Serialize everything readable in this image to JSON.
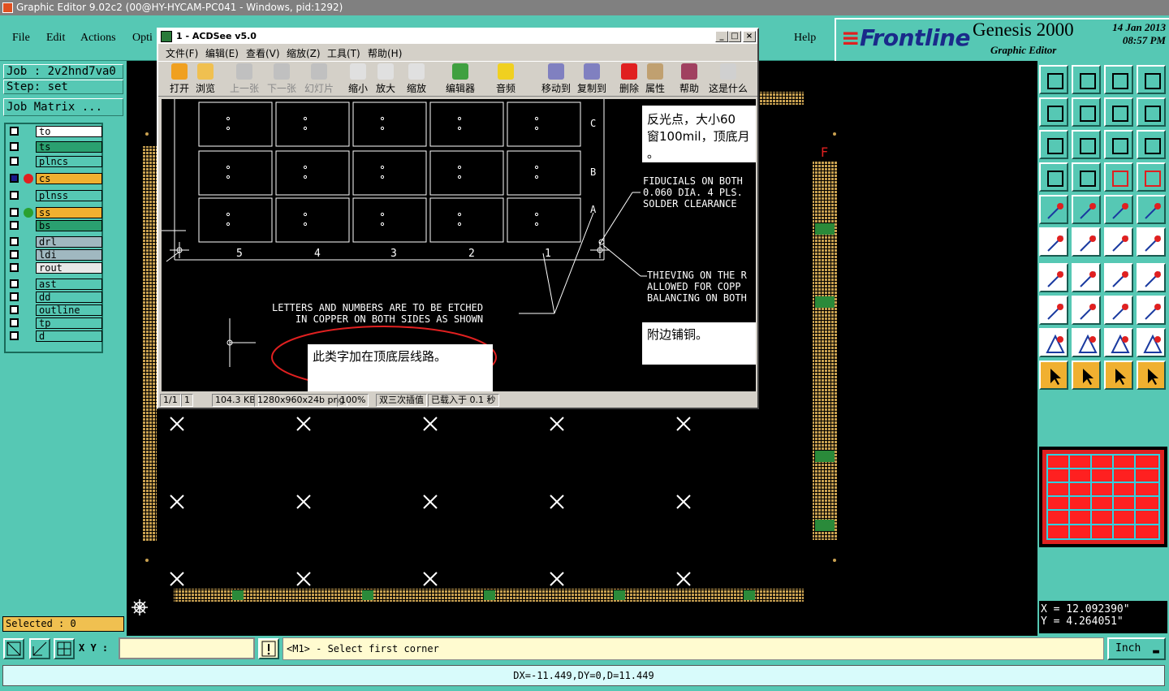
{
  "window": {
    "title": "Graphic Editor 9.02c2 (00@HY-HYCAM-PC041 - Windows, pid:1292)"
  },
  "menu": {
    "file": "File",
    "edit": "Edit",
    "actions": "Actions",
    "options": "Opti",
    "help": "Help"
  },
  "brand": {
    "logo": "Frontline",
    "product": "Genesis 2000",
    "sub": "Graphic Editor",
    "date": "14 Jan 2013",
    "time": "08:57 PM"
  },
  "job": {
    "job": "Job : 2v2hnd7va0",
    "step": "Step: set",
    "matrix": "Job Matrix ..."
  },
  "layers": [
    {
      "name": "to",
      "color": "#ffffff"
    },
    {
      "name": "ts",
      "color": "#2aa070"
    },
    {
      "name": "plncs",
      "color": "#56c8b4"
    },
    {
      "name": "cs",
      "color": "#f0b030"
    },
    {
      "name": "plnss",
      "color": "#56c8b4"
    },
    {
      "name": "ss",
      "color": "#f0b030"
    },
    {
      "name": "bs",
      "color": "#2aa070"
    },
    {
      "name": "drl",
      "color": "#a0b8c0"
    },
    {
      "name": "ldi",
      "color": "#a0b8c0"
    },
    {
      "name": "rout",
      "color": "#e8e8e8"
    },
    {
      "name": "ast",
      "color": "#56c8b4"
    },
    {
      "name": "dd",
      "color": "#56c8b4"
    },
    {
      "name": "outline",
      "color": "#56c8b4"
    },
    {
      "name": "tp",
      "color": "#56c8b4"
    },
    {
      "name": "d",
      "color": "#56c8b4"
    }
  ],
  "selected": "Selected : 0",
  "cadMarker": "F",
  "coords": {
    "x": "X =  12.092390\"",
    "y": "Y =  4.264051\""
  },
  "cmd": {
    "xy_label": "X Y :",
    "xy_value": "",
    "prompt": "<M1> - Select first corner",
    "units": "Inch"
  },
  "status": "DX=-11.449,DY=0,D=11.449",
  "acdsee": {
    "title": "1 - ACDSee v5.0",
    "menu": [
      "文件(F)",
      "编辑(E)",
      "查看(V)",
      "缩放(Z)",
      "工具(T)",
      "帮助(H)"
    ],
    "toolbar": [
      "打开",
      "浏览",
      "上一张",
      "下一张",
      "幻灯片",
      "缩小",
      "放大",
      "缩放",
      "编辑器",
      "音频",
      "移动到",
      "复制到",
      "删除",
      "属性",
      "帮助",
      "这是什么"
    ],
    "status": [
      "1/1",
      "1",
      "104.3 KB",
      "1280x960x24b png",
      "100%",
      "双三次插值",
      "已载入于 0.1 秒"
    ],
    "image": {
      "cols": [
        "5",
        "4",
        "3",
        "2",
        "1"
      ],
      "rows": [
        "C",
        "B",
        "A"
      ],
      "fid": [
        "FIDUCIALS ON BOTH",
        "0.060 DIA. 4 PLS.",
        "SOLDER CLEARANCE"
      ],
      "thv": [
        "THIEVING ON THE R",
        "ALLOWED FOR COPP",
        "BALANCING ON BOTH"
      ],
      "letters": [
        "LETTERS AND NUMBERS ARE TO BE ETCHED",
        "IN COPPER ON BOTH SIDES AS SHOWN"
      ],
      "note1": [
        "反光点，大小60",
        "窗100mil，顶底月",
        "。"
      ],
      "note2": "附边铺铜。",
      "note3": "此类字加在顶底层线路。"
    }
  }
}
